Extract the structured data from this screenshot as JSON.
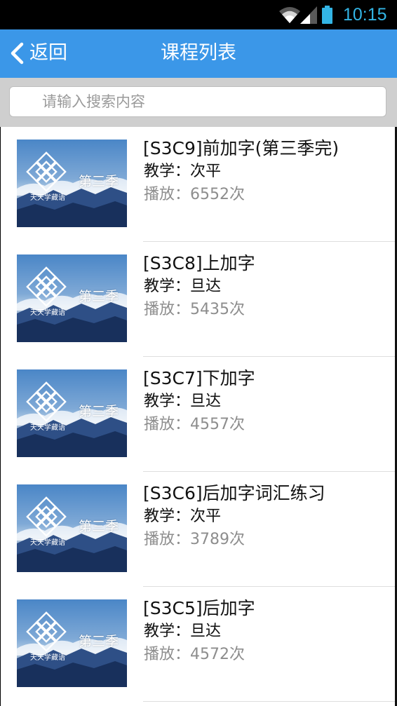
{
  "status_bar": {
    "time": "10:15",
    "icons": [
      "wifi-icon",
      "signal-icon",
      "battery-icon"
    ],
    "accent_color": "#33b5e5"
  },
  "header": {
    "back_label": "返回",
    "title": "课程列表",
    "background_color": "#3b97e8"
  },
  "search": {
    "placeholder": "请输入搜索内容",
    "value": ""
  },
  "courses": [
    {
      "title": "[S3C9]前加字(第三季完)",
      "teacher": "教学：次平",
      "plays": "播放：6552次",
      "thumb_season": "第三季",
      "thumb_brand": "天天学藏语"
    },
    {
      "title": "[S3C8]上加字",
      "teacher": "教学：旦达",
      "plays": "播放：5435次",
      "thumb_season": "第三季",
      "thumb_brand": "天天学藏语"
    },
    {
      "title": "[S3C7]下加字",
      "teacher": "教学：旦达",
      "plays": "播放：4557次",
      "thumb_season": "第三季",
      "thumb_brand": "天天学藏语"
    },
    {
      "title": "[S3C6]后加字词汇练习",
      "teacher": "教学：次平",
      "plays": "播放：3789次",
      "thumb_season": "第三季",
      "thumb_brand": "天天学藏语"
    },
    {
      "title": "[S3C5]后加字",
      "teacher": "教学：旦达",
      "plays": "播放：4572次",
      "thumb_season": "第三季",
      "thumb_brand": "天天学藏语"
    }
  ]
}
